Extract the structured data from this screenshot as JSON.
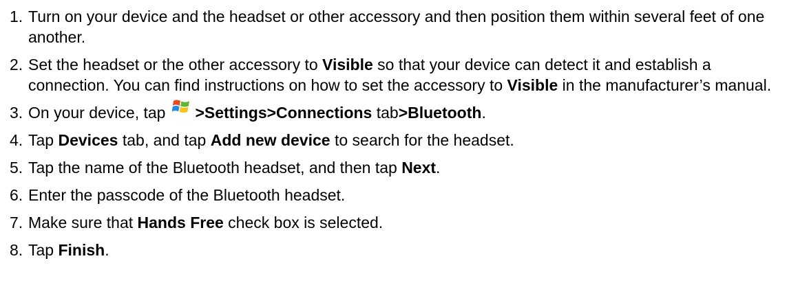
{
  "steps": [
    {
      "number": "1.",
      "text": "Turn on your device and the headset or other accessory and then position them within several feet of one another."
    },
    {
      "number": "2.",
      "t1": "Set the headset or the other accessory to ",
      "b1": "Visible",
      "t2": " so that your device can detect it and establish a connection. You can find instructions on how to set the accessory to ",
      "b2": "Visible",
      "t3": " in the manufacturer’s manual."
    },
    {
      "number": "3.",
      "t1": "On your device, tap",
      "icon": "windows-start-icon",
      "b1": ">Settings>Connections",
      "t2": " tab",
      "b2": ">Bluetooth",
      "t3": "."
    },
    {
      "number": "4.",
      "t1": "Tap ",
      "b1": "Devices",
      "t2": " tab, and tap ",
      "b2": "Add new device",
      "t3": " to search for the headset."
    },
    {
      "number": "5.",
      "t1": "Tap the name of the Bluetooth headset, and then tap ",
      "b1": "Next",
      "t2": "."
    },
    {
      "number": "6.",
      "text": "Enter the passcode of the Bluetooth headset."
    },
    {
      "number": "7.",
      "t1": "Make sure that ",
      "b1": "Hands Free",
      "t2": " check box is selected."
    },
    {
      "number": "8.",
      "t1": "Tap ",
      "b1": "Finish",
      "t2": "."
    }
  ],
  "colors": {
    "text": "#000000",
    "background": "#ffffff",
    "icon_red": "#e8481c",
    "icon_green": "#5cb82e",
    "icon_blue": "#1e8be0",
    "icon_yellow": "#f7c21a"
  }
}
